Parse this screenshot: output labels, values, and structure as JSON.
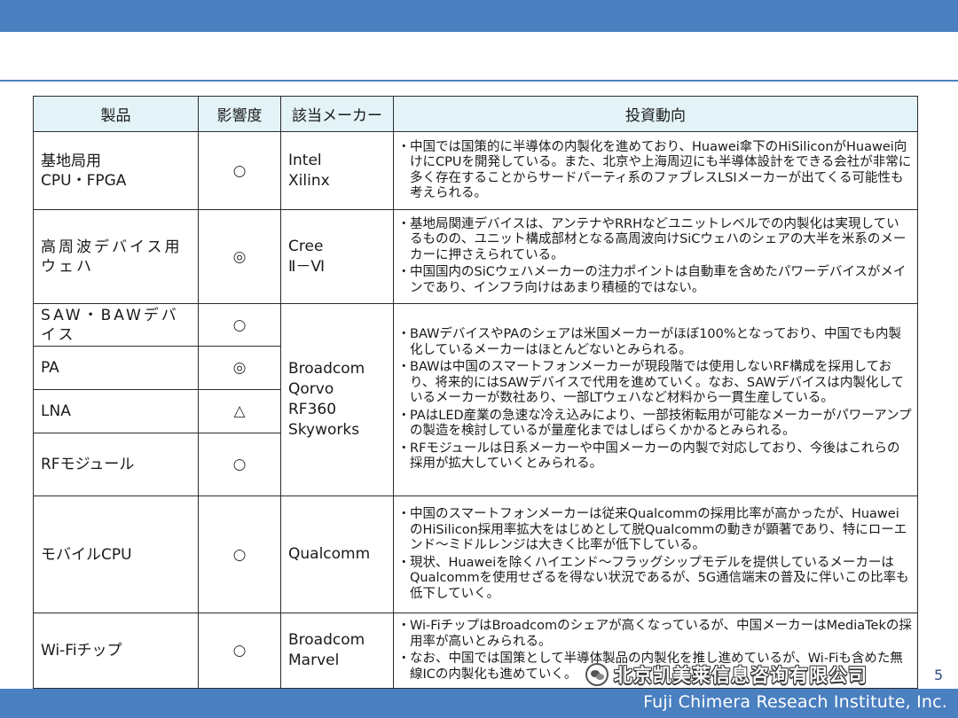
{
  "footer": {
    "company": "Fuji Chimera Reseach Institute, Inc.",
    "page_number": "5"
  },
  "watermark": {
    "text": "北京凯美莱信息咨询有限公司"
  },
  "table": {
    "headers": {
      "product": "製品",
      "impact": "影響度",
      "maker": "該当メーカー",
      "investment": "投資動向"
    },
    "rows": {
      "basestation": {
        "product": [
          "基地局用",
          "CPU・FPGA"
        ],
        "impact": "○",
        "makers": [
          "Intel",
          "Xilinx"
        ],
        "investment": [
          "中国では国策的に半導体の内製化を進めており、Huawei傘下のHiSiliconがHuawei向けにCPUを開発している。また、北京や上海周辺にも半導体設計をできる会社が非常に多く存在することからサードパーティ系のファブレスLSIメーカーが出てくる可能性も考えられる。"
        ]
      },
      "rf_wafer": {
        "product": [
          "高周波デバイス用",
          "ウェハ"
        ],
        "impact": "◎",
        "makers": [
          "Cree",
          "Ⅱ－Ⅵ"
        ],
        "investment": [
          "基地局関連デバイスは、アンテナやRRHなどユニットレベルでの内製化は実現しているものの、ユニット構成部材となる高周波向けSiCウェハのシェアの大半を米系のメーカーに押さえられている。",
          "中国国内のSiCウェハメーカーの注力ポイントは自動車を含めたパワーデバイスがメインであり、インフラ向けはあまり積極的ではない。"
        ]
      },
      "rf_group": {
        "items": [
          {
            "product": "SAW・BAWデバイス",
            "impact": "○"
          },
          {
            "product": "PA",
            "impact": "◎"
          },
          {
            "product": "LNA",
            "impact": "△"
          },
          {
            "product": "RFモジュール",
            "impact": "○"
          }
        ],
        "makers": [
          "Broadcom",
          "Qorvo",
          "RF360",
          "Skyworks"
        ],
        "investment": [
          "BAWデバイスやPAのシェアは米国メーカーがほぼ100%となっており、中国でも内製化しているメーカーはほとんどないとみられる。",
          "BAWは中国のスマートフォンメーカーが現段階では使用しないRF構成を採用しており、将来的にはSAWデバイスで代用を進めていく。なお、SAWデバイスは内製化しているメーカーが数社あり、一部LTウェハなど材料から一貫生産している。",
          "PAはLED産業の急速な冷え込みにより、一部技術転用が可能なメーカーがパワーアンプの製造を検討しているが量産化まではしばらくかかるとみられる。",
          "RFモジュールは日系メーカーや中国メーカーの内製で対応しており、今後はこれらの採用が拡大していくとみられる。"
        ]
      },
      "mobile_cpu": {
        "product": "モバイルCPU",
        "impact": "○",
        "makers": [
          "Qualcomm"
        ],
        "investment": [
          "中国のスマートフォンメーカーは従来Qualcommの採用比率が高かったが、HuaweiのHiSilicon採用率拡大をはじめとして脱Qualcommの動きが顕著であり、特にローエンド～ミドルレンジは大きく比率が低下している。",
          "現状、Huaweiを除くハイエンド～フラッグシップモデルを提供しているメーカーはQualcommを使用せざるを得ない状況であるが、5G通信端末の普及に伴いこの比率も低下していく。"
        ]
      },
      "wifi": {
        "product": "Wi-Fiチップ",
        "impact": "○",
        "makers": [
          "Broadcom",
          "Marvel"
        ],
        "investment": [
          "Wi-FiチップはBroadcomのシェアが高くなっているが、中国メーカーはMediaTekの採用率が高いとみられる。",
          "なお、中国では国策として半導体製品の内製化を推し進めているが、Wi-Fiも含めた無線ICの内製化も進めていく。"
        ]
      }
    }
  }
}
